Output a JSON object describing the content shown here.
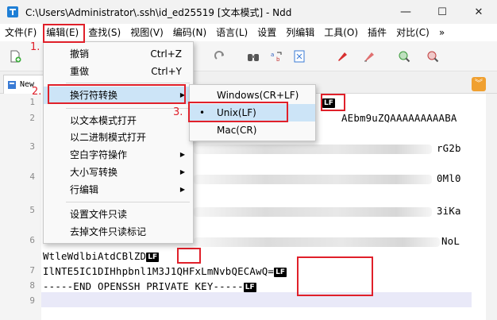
{
  "window": {
    "title": "C:\\Users\\Administrator\\.ssh\\id_ed25519 [文本模式] - Ndd",
    "controls": {
      "minimize": "—",
      "maximize": "☐",
      "close": "✕"
    }
  },
  "menubar": {
    "items": [
      "文件(F)",
      "编辑(E)",
      "查找(S)",
      "视图(V)",
      "编码(N)",
      "语言(L)",
      "设置",
      "列编辑",
      "工具(O)",
      "插件",
      "对比(C)"
    ],
    "overflow": "»"
  },
  "tab": {
    "label": "New"
  },
  "editor": {
    "line_numbers": [
      "1",
      "2",
      "3",
      "4",
      "5",
      "6",
      "7",
      "8",
      "9"
    ],
    "visible_code": {
      "line2_tail": "AEbm9uZQAAAAAAAAABA",
      "line3_tail": "rG2b",
      "line4_tail": "0Ml0",
      "line5_tail": "3iKa",
      "line6_tail": "NoL",
      "line6_wrap": "WtleWdlbiAtdCBlZD",
      "line7": "IlNTE5IC1DIHhpbnl1M3J1QHFxLmNvbQECAwQ=",
      "line8": "-----END OPENSSH PRIVATE KEY-----"
    },
    "eol_marker": "LF"
  },
  "edit_menu": {
    "items": [
      {
        "label": "撤销",
        "shortcut": "Ctrl+Z"
      },
      {
        "label": "重做",
        "shortcut": "Ctrl+Y"
      },
      {
        "label": "换行符转换",
        "submenu": true
      },
      {
        "label": "以文本模式打开"
      },
      {
        "label": "以二进制模式打开"
      },
      {
        "label": "空白字符操作",
        "submenu": true
      },
      {
        "label": "大小写转换",
        "submenu": true
      },
      {
        "label": "行编辑",
        "submenu": true
      },
      {
        "label": "设置文件只读"
      },
      {
        "label": "去掉文件只读标记"
      }
    ]
  },
  "eol_submenu": {
    "items": [
      {
        "label": "Windows(CR+LF)",
        "checked": false
      },
      {
        "label": "Unix(LF)",
        "checked": true
      },
      {
        "label": "Mac(CR)",
        "checked": false
      }
    ],
    "check_mark": "•"
  },
  "annotations": {
    "step1": "1.",
    "step2": "2.",
    "step3": "3.",
    "highlight_color": "#e0202a"
  },
  "colors": {
    "menu_highlight": "#cce4f7",
    "current_line": "#e9e9f8",
    "lf_badge_bg": "#000000"
  }
}
